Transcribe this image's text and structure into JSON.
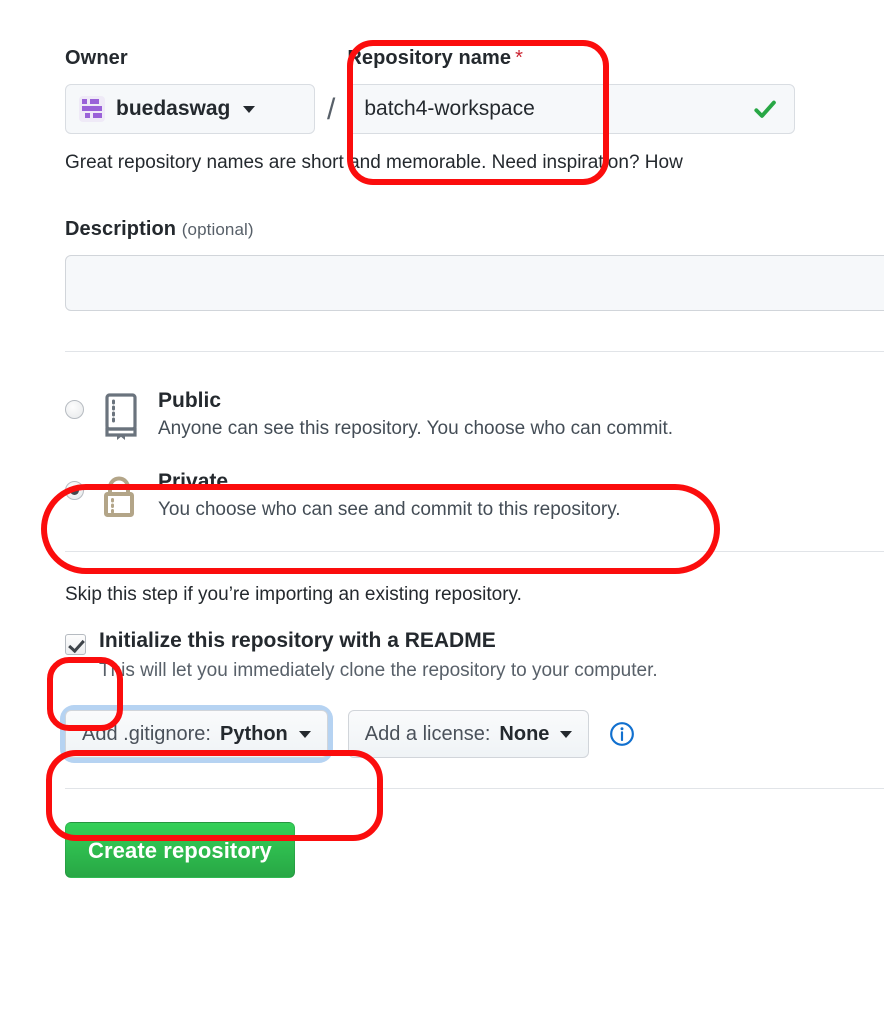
{
  "owner": {
    "label": "Owner",
    "name": "buedaswag",
    "avatar_color": "#9a62d8"
  },
  "repo_name": {
    "label": "Repository name",
    "required_mark": "*",
    "value": "batch4-workspace",
    "valid_icon": "check-icon",
    "valid_color": "#28a745"
  },
  "separator": "/",
  "helper_text": "Great repository names are short and memorable. Need inspiration? How",
  "description": {
    "label": "Description",
    "optional_label": "(optional)",
    "value": ""
  },
  "visibility": {
    "options": [
      {
        "id": "public",
        "title": "Public",
        "subtitle": "Anyone can see this repository. You choose who can commit.",
        "selected": false,
        "icon": "repo-book-icon",
        "icon_color": "#6a737d"
      },
      {
        "id": "private",
        "title": "Private",
        "subtitle": "You choose who can see and commit to this repository.",
        "selected": true,
        "icon": "lock-icon",
        "icon_color": "#b3a588"
      }
    ]
  },
  "initialize": {
    "skip_note": "Skip this step if you’re importing an existing repository.",
    "readme_label": "Initialize this repository with a README",
    "readme_sub": "This will let you immediately clone the repository to your computer.",
    "readme_checked": true
  },
  "dropdowns": {
    "gitignore": {
      "prefix": "Add .gitignore:",
      "value": "Python",
      "focused": true
    },
    "license": {
      "prefix": "Add a license:",
      "value": "None",
      "focused": false
    },
    "info_icon": "info-circle-icon",
    "info_color": "#1170cf"
  },
  "submit": {
    "label": "Create repository",
    "color": "#28a745"
  },
  "annotations": {
    "color": "#fb0d0d",
    "boxes": [
      {
        "id": "anno-repo-name",
        "target": "repository-name-field"
      },
      {
        "id": "anno-private",
        "target": "visibility-option-private"
      },
      {
        "id": "anno-readme-cb",
        "target": "initialize-readme-checkbox"
      },
      {
        "id": "anno-gitignore",
        "target": "gitignore-dropdown"
      }
    ]
  }
}
